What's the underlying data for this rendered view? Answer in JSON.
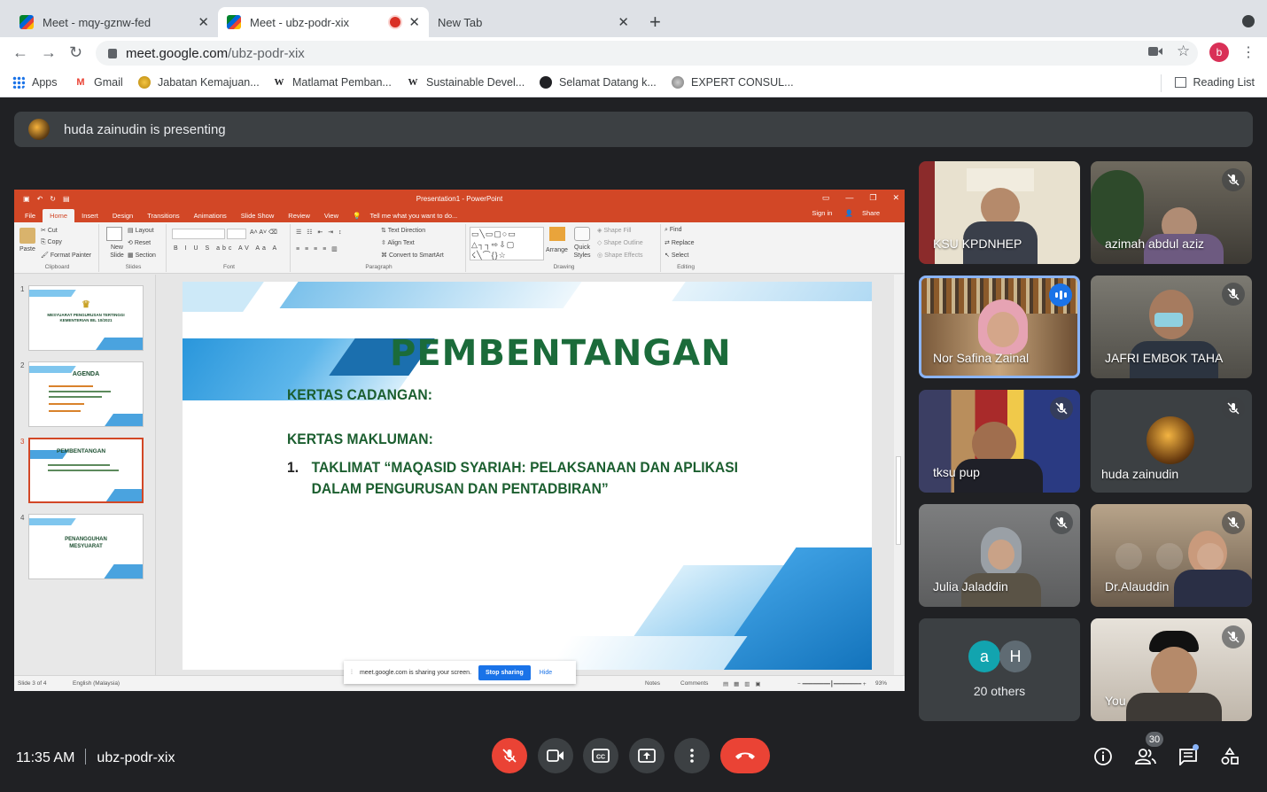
{
  "browser": {
    "tabs": [
      {
        "title": "Meet - mqy-gznw-fed",
        "active": false
      },
      {
        "title": "Meet - ubz-podr-xix",
        "active": true,
        "recording": true
      },
      {
        "title": "New Tab",
        "active": false
      }
    ],
    "url_host": "meet.google.com",
    "url_path": "/ubz-podr-xix",
    "profile_initial": "b",
    "bookmarks": [
      {
        "label": "Apps",
        "icon": "apps-grid-icon"
      },
      {
        "label": "Gmail",
        "icon": "gmail-icon"
      },
      {
        "label": "Jabatan Kemajuan...",
        "icon": "crest-icon"
      },
      {
        "label": "Matlamat Pemban...",
        "icon": "wikipedia-icon"
      },
      {
        "label": "Sustainable Devel...",
        "icon": "wikipedia-icon"
      },
      {
        "label": "Selamat Datang k...",
        "icon": "globe-icon"
      },
      {
        "label": "EXPERT CONSUL...",
        "icon": "seal-icon"
      }
    ],
    "reading_list": "Reading List"
  },
  "meet": {
    "presenting_banner": "huda zainudin is presenting",
    "meeting_time": "11:35 AM",
    "meeting_code": "ubz-podr-xix",
    "participant_count": "30",
    "colors": {
      "end_call": "#ea4335",
      "muted": "#ea4335",
      "speaking": "#1a73e8"
    }
  },
  "powerpoint": {
    "window_title": "Presentation1 - PowerPoint",
    "ribbon_tabs": [
      "File",
      "Home",
      "Insert",
      "Design",
      "Transitions",
      "Animations",
      "Slide Show",
      "Review",
      "View"
    ],
    "tell_me": "Tell me what you want to do...",
    "sign_in": "Sign in",
    "share": "Share",
    "ribbon": {
      "clipboard": {
        "paste": "Paste",
        "cut": "Cut",
        "copy": "Copy",
        "format_painter": "Format Painter",
        "label": "Clipboard"
      },
      "slides": {
        "new_slide": "New Slide",
        "layout": "Layout",
        "reset": "Reset",
        "section": "Section",
        "label": "Slides"
      },
      "font_label": "Font",
      "paragraph": {
        "text_direction": "Text Direction",
        "align_text": "Align Text",
        "smartart": "Convert to SmartArt",
        "label": "Paragraph"
      },
      "drawing": {
        "arrange": "Arrange",
        "quick_styles": "Quick Styles",
        "shape_fill": "Shape Fill",
        "shape_outline": "Shape Outline",
        "shape_effects": "Shape Effects",
        "label": "Drawing"
      },
      "editing": {
        "find": "Find",
        "replace": "Replace",
        "select": "Select",
        "label": "Editing"
      }
    },
    "thumbnails": [
      {
        "num": "1",
        "text": "MESYUARAT PENGURUSAN TERTINGGI KEMENTERIAN BIL 10/2021"
      },
      {
        "num": "2",
        "text": "AGENDA"
      },
      {
        "num": "3",
        "text": "PEMBENTANGAN"
      },
      {
        "num": "4",
        "text": "PENANGGUHAN MESYUARAT"
      }
    ],
    "slide": {
      "title": "PEMBENTANGAN",
      "heading1": "KERTAS CADANGAN:",
      "heading2": "KERTAS MAKLUMAN:",
      "item_num": "1.",
      "item_line1": "TAKLIMAT “MAQASID SYARIAH: PELAKSANAAN DAN APLIKASI",
      "item_line2": "DALAM PENGURUSAN DAN PENTADBIRAN”"
    },
    "status": {
      "slide_of": "Slide 3 of 4",
      "language": "English (Malaysia)",
      "notes": "Notes",
      "comments": "Comments",
      "zoom": "93%"
    },
    "share_notice": {
      "text": "meet.google.com is sharing your screen.",
      "stop": "Stop sharing",
      "hide": "Hide"
    }
  },
  "participants": [
    {
      "name": "KSU KPDNHEP",
      "muted": false
    },
    {
      "name": "azimah abdul aziz",
      "muted": true
    },
    {
      "name": "Nor Safina Zainal",
      "muted": false,
      "speaking": true
    },
    {
      "name": "JAFRI EMBOK TAHA",
      "muted": true
    },
    {
      "name": "tksu pup",
      "muted": true
    },
    {
      "name": "huda zainudin",
      "muted": true
    },
    {
      "name": "Julia Jaladdin",
      "muted": true
    },
    {
      "name": "Dr.Alauddin",
      "muted": true
    },
    {
      "name": "20 others",
      "avatars": [
        "a",
        "H"
      ]
    },
    {
      "name": "You",
      "muted": true
    }
  ]
}
